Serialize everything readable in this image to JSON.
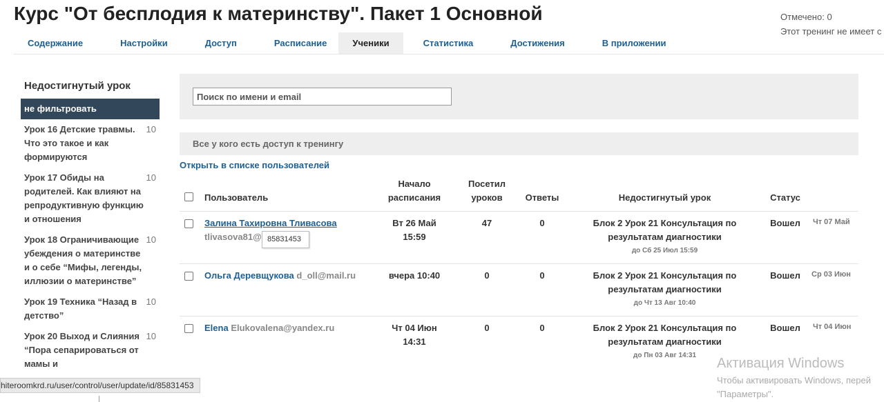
{
  "page": {
    "title": "Курс \"От бесплодия к материнству\". Пакет 1 Основной",
    "marked": "Отмечено: 0",
    "training_note": "Этот тренинг не имеет с"
  },
  "tabs": [
    {
      "label": "Содержание"
    },
    {
      "label": "Настройки"
    },
    {
      "label": "Доступ"
    },
    {
      "label": "Расписание"
    },
    {
      "label": "Ученики",
      "active": true
    },
    {
      "label": "Статистика"
    },
    {
      "label": "Достижения"
    },
    {
      "label": "В приложении"
    }
  ],
  "sidebar": {
    "title": "Недостигнутый урок",
    "filter_all": "не фильтровать",
    "lessons": [
      {
        "name": "Урок 16 Детские травмы. Что это такое и как формируются",
        "count": "10"
      },
      {
        "name": "Урок 17 Обиды на родителей. Как влияют на репродуктивную функцию и отношения",
        "count": "10"
      },
      {
        "name": "Урок 18 Ограничивающие убеждения о материнстве и о себе “Мифы, легенды, иллюзии о материнстве”",
        "count": "10"
      },
      {
        "name": "Урок 19 Техника “Назад в детство”",
        "count": "10"
      },
      {
        "name": "Урок 20 Выход и Слияния “Пора сепарироваться от мамы и",
        "count": "10"
      }
    ]
  },
  "search": {
    "placeholder": "Поиск по имени и email"
  },
  "access_filter": "Все у кого есть доступ к тренингу",
  "open_in_users": "Открыть в списке пользователей",
  "table": {
    "headers": {
      "user": "Пользователь",
      "schedule_start_1": "Начало",
      "schedule_start_2": "расписания",
      "visited_1": "Посетил",
      "visited_2": "уроков",
      "answers": "Ответы",
      "lesson": "Недостигнутый урок",
      "status": "Статус"
    },
    "rows": [
      {
        "name": "Залина Тахировна Тливасова",
        "email": "tlivasova81@r",
        "start_1": "Вт 26 Май",
        "start_2": "15:59",
        "visited": "47",
        "answers": "0",
        "lesson_1": "Блок 2 Урок 21 Консультация по",
        "lesson_2": "результатам диагностики",
        "deadline": "до Сб 25 Июл 15:59",
        "status": "Вошел",
        "last_date": "Чт 07 Май"
      },
      {
        "name": "Ольга Деревщукова",
        "email": "d_oll@mail.ru",
        "start_1": "вчера 10:40",
        "start_2": "",
        "visited": "0",
        "answers": "0",
        "lesson_1": "Блок 2 Урок 21 Консультация по",
        "lesson_2": "результатам диагностики",
        "deadline": "до Чт 13 Авг 10:40",
        "status": "Вошел",
        "last_date": "Ср 03 Июн"
      },
      {
        "name": "Elena",
        "email": "Elukovalena@yandex.ru",
        "start_1": "Чт 04 Июн",
        "start_2": "14:31",
        "visited": "0",
        "answers": "0",
        "lesson_1": "Блок 2 Урок 21 Консультация по",
        "lesson_2": "результатам диагностики",
        "deadline": "до Пн 03 Авг 14:31",
        "status": "Вошел",
        "last_date": "Чт 04 Июн"
      }
    ]
  },
  "tooltip": "85831453",
  "status_url": "hiteroomkrd.ru/user/control/user/update/id/85831453",
  "windows": {
    "title": "Активация Windows",
    "line1": "Чтобы активировать Windows, перей",
    "line2": "\"Параметры\"."
  }
}
